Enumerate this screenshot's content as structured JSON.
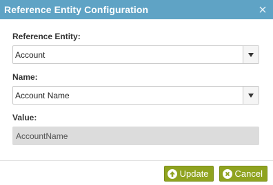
{
  "dialog": {
    "title": "Reference Entity Configuration",
    "close_icon": "close-icon"
  },
  "fields": {
    "reference_entity": {
      "label": "Reference Entity:",
      "value": "Account"
    },
    "name": {
      "label": "Name:",
      "value": "Account Name"
    },
    "value": {
      "label": "Value:",
      "value": "AccountName"
    }
  },
  "buttons": {
    "update_label": "Update",
    "cancel_label": "Cancel",
    "update_icon": "arrow-up-icon",
    "cancel_icon": "x-circle-icon"
  },
  "colors": {
    "titlebar": "#5fa3c5",
    "button": "#8fa31f"
  }
}
